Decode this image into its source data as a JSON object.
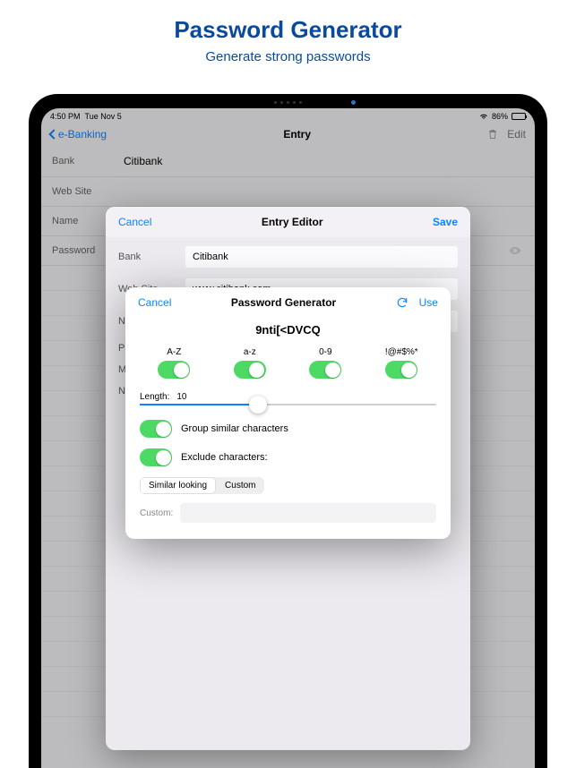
{
  "promo": {
    "title": "Password Generator",
    "subtitle": "Generate strong passwords"
  },
  "status": {
    "time": "4:50 PM",
    "date": "Tue Nov 5",
    "battery": "86%"
  },
  "nav": {
    "back": "e-Banking",
    "title": "Entry",
    "edit": "Edit"
  },
  "entry": {
    "bank_label": "Bank",
    "bank_value": "Citibank",
    "website_label": "Web Site",
    "name_label": "Name",
    "password_label": "Password"
  },
  "editor": {
    "cancel": "Cancel",
    "title": "Entry Editor",
    "save": "Save",
    "bank_label": "Bank",
    "bank_value": "Citibank",
    "website_label": "Web Site",
    "website_value": "www.citibank.com",
    "name_label": "Name",
    "password_label": "Pas",
    "mo_label": "Mo",
    "no_label": "No"
  },
  "gen": {
    "cancel": "Cancel",
    "title": "Password Generator",
    "use": "Use",
    "password": "9nti[<DVCQ",
    "switches": {
      "upper": "A-Z",
      "lower": "a-z",
      "digits": "0-9",
      "symbols": "!@#$%*"
    },
    "length_label": "Length:",
    "length_value": "10",
    "group_similar": "Group similar characters",
    "exclude": "Exclude characters:",
    "seg_similar": "Similar looking",
    "seg_custom": "Custom",
    "custom_label": "Custom:"
  }
}
